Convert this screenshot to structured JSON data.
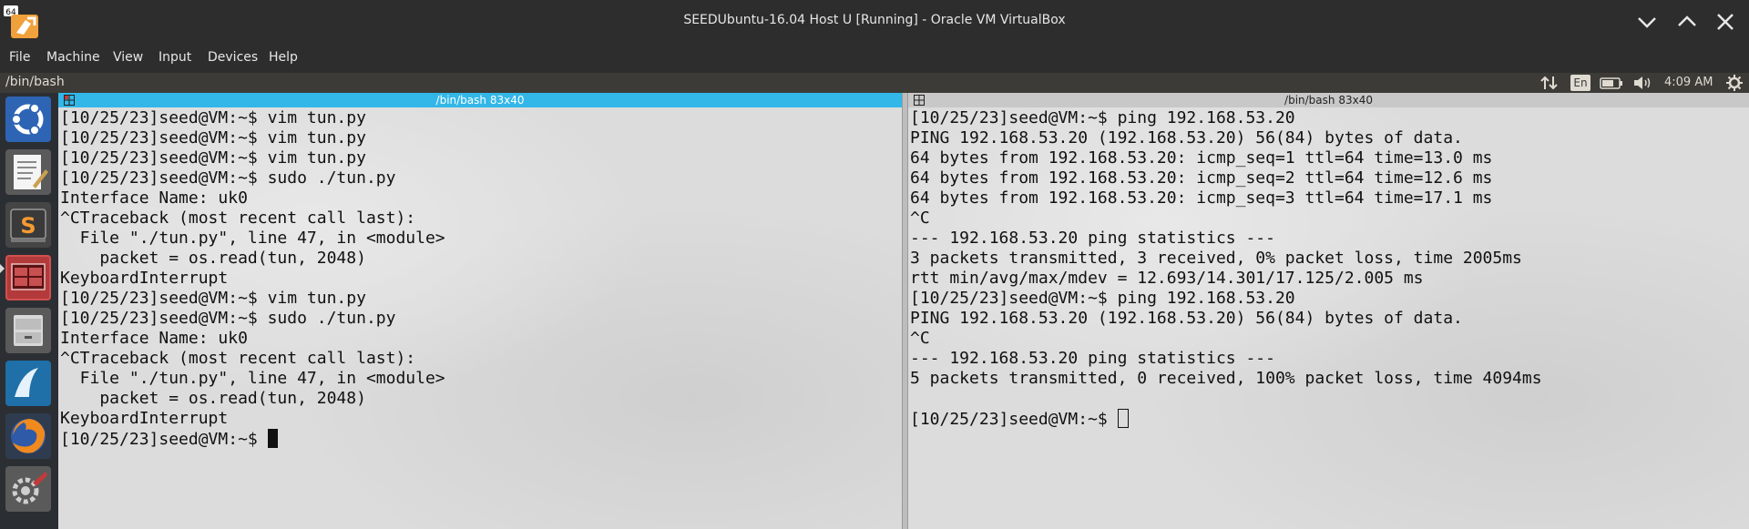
{
  "vbox": {
    "title": "SEEDUbuntu-16.04 Host U [Running] - Oracle VM VirtualBox",
    "logo_badge": "64",
    "menu": [
      "File",
      "Machine",
      "View",
      "Input",
      "Devices",
      "Help"
    ]
  },
  "ubuntu_panel": {
    "title": "/bin/bash",
    "keyboard": "En",
    "time": "4:09 AM"
  },
  "launcher": {
    "items": [
      "ubuntu-dash",
      "text-editor",
      "sublime-text",
      "terminal",
      "file-manager",
      "wireshark",
      "firefox",
      "system-settings"
    ]
  },
  "terminals": {
    "left": {
      "title": "/bin/bash 83x40",
      "active": true,
      "lines": [
        "[10/25/23]seed@VM:~$ vim tun.py",
        "[10/25/23]seed@VM:~$ vim tun.py",
        "[10/25/23]seed@VM:~$ vim tun.py",
        "[10/25/23]seed@VM:~$ sudo ./tun.py",
        "Interface Name: uk0",
        "^CTraceback (most recent call last):",
        "  File \"./tun.py\", line 47, in <module>",
        "    packet = os.read(tun, 2048)",
        "KeyboardInterrupt",
        "[10/25/23]seed@VM:~$ vim tun.py",
        "[10/25/23]seed@VM:~$ sudo ./tun.py",
        "Interface Name: uk0",
        "^CTraceback (most recent call last):",
        "  File \"./tun.py\", line 47, in <module>",
        "    packet = os.read(tun, 2048)",
        "KeyboardInterrupt"
      ],
      "prompt": "[10/25/23]seed@VM:~$ "
    },
    "right": {
      "title": "/bin/bash 83x40",
      "active": false,
      "lines": [
        "[10/25/23]seed@VM:~$ ping 192.168.53.20",
        "PING 192.168.53.20 (192.168.53.20) 56(84) bytes of data.",
        "64 bytes from 192.168.53.20: icmp_seq=1 ttl=64 time=13.0 ms",
        "64 bytes from 192.168.53.20: icmp_seq=2 ttl=64 time=12.6 ms",
        "64 bytes from 192.168.53.20: icmp_seq=3 ttl=64 time=17.1 ms",
        "^C",
        "--- 192.168.53.20 ping statistics ---",
        "3 packets transmitted, 3 received, 0% packet loss, time 2005ms",
        "rtt min/avg/max/mdev = 12.693/14.301/17.125/2.005 ms",
        "[10/25/23]seed@VM:~$ ping 192.168.53.20",
        "PING 192.168.53.20 (192.168.53.20) 56(84) bytes of data.",
        "^C",
        "--- 192.168.53.20 ping statistics ---",
        "5 packets transmitted, 0 received, 100% packet loss, time 4094ms",
        ""
      ],
      "prompt": "[10/25/23]seed@VM:~$ "
    }
  },
  "colors": {
    "active_title_bg": "#33b7e8",
    "inactive_title_bg": "#c8c8c8",
    "launcher_bg": "#2b2f33",
    "panel_bg": "#3c3b37"
  }
}
